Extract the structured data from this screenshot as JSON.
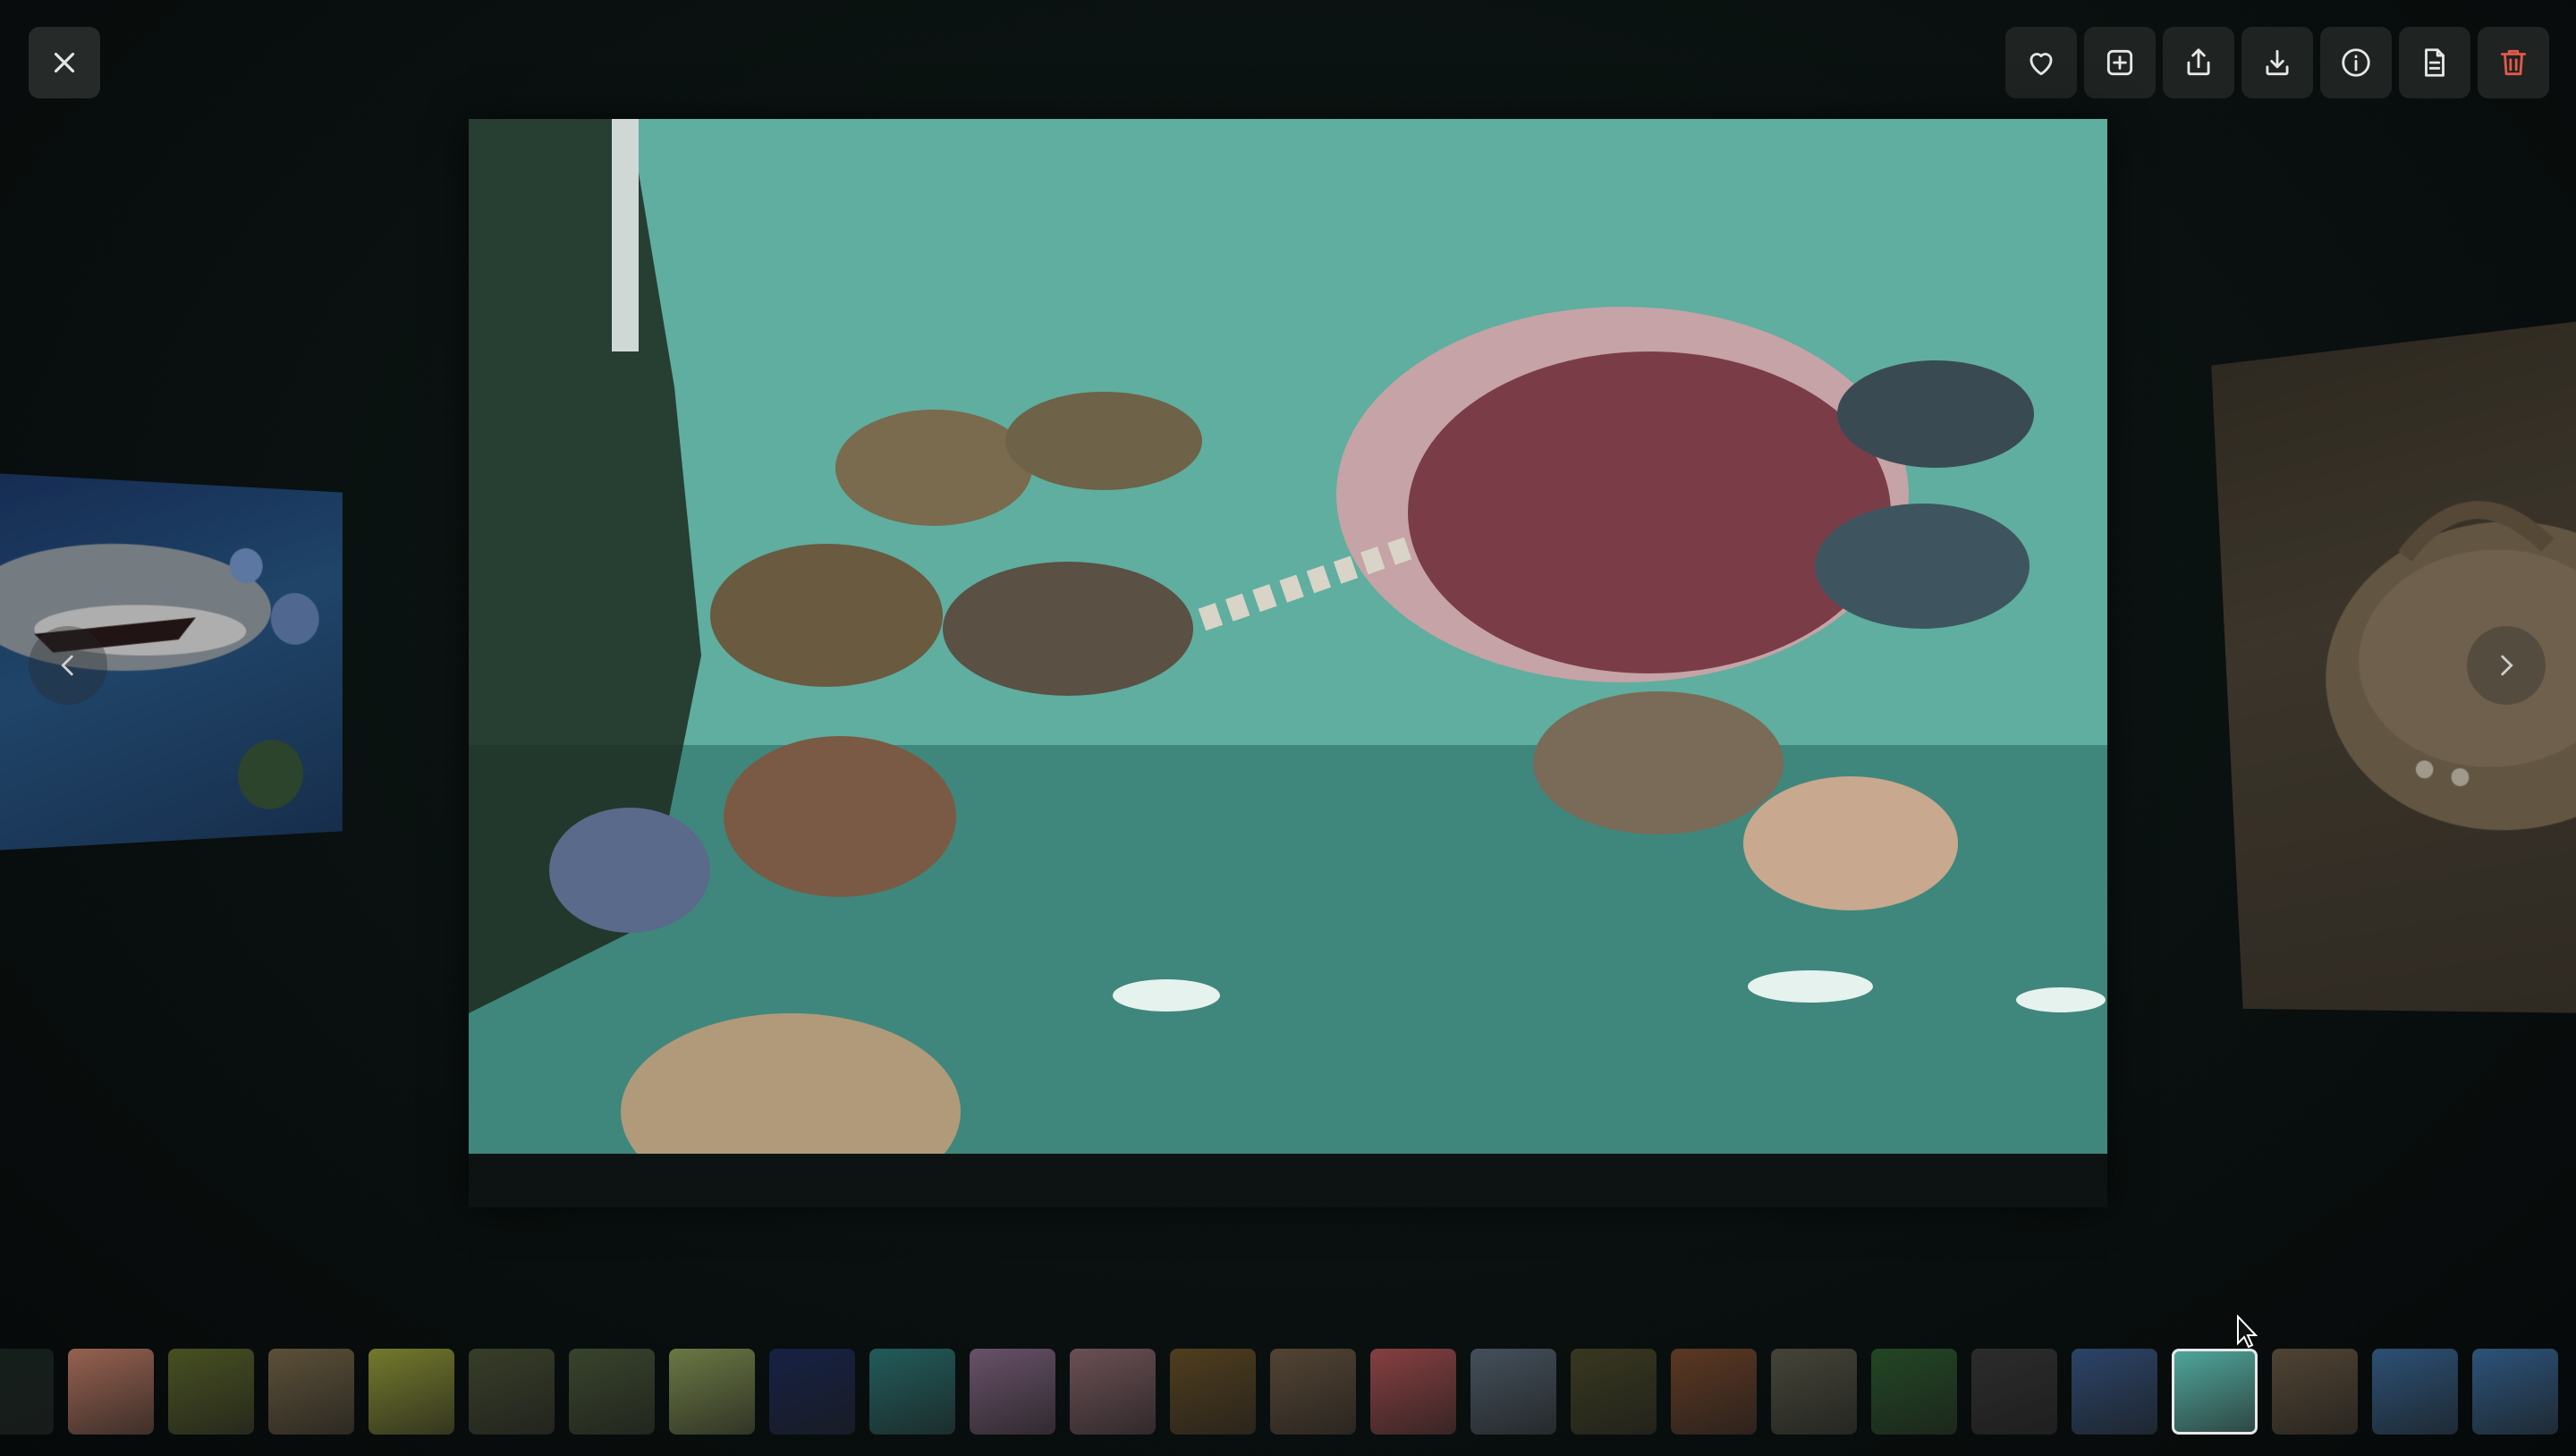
{
  "viewer": {
    "close_icon": "close-icon",
    "toolbar": [
      {
        "name": "favorite-button",
        "icon": "heart-icon"
      },
      {
        "name": "add-to-album-button",
        "icon": "plus-square-icon"
      },
      {
        "name": "share-button",
        "icon": "share-icon"
      },
      {
        "name": "download-button",
        "icon": "download-icon"
      },
      {
        "name": "info-button",
        "icon": "info-icon"
      },
      {
        "name": "file-info-button",
        "icon": "document-icon"
      },
      {
        "name": "delete-button",
        "icon": "trash-icon",
        "color": "#e05a4a"
      }
    ],
    "prev_icon": "chevron-left-icon",
    "next_icon": "chevron-right-icon"
  },
  "filmstrip": {
    "active_index": 22,
    "thumbs": [
      {
        "color": "#1a2a22"
      },
      {
        "color": "#c8826a"
      },
      {
        "color": "#5e6a2c"
      },
      {
        "color": "#7a6a4a"
      },
      {
        "color": "#9aa23a"
      },
      {
        "color": "#4a5236"
      },
      {
        "color": "#4a5a3a"
      },
      {
        "color": "#8ea05a"
      },
      {
        "color": "#1e2c5a"
      },
      {
        "color": "#2c7a78"
      },
      {
        "color": "#8a6c8a"
      },
      {
        "color": "#8e6a70"
      },
      {
        "color": "#6a5228"
      },
      {
        "color": "#6e5a44"
      },
      {
        "color": "#b25456"
      },
      {
        "color": "#5a6a78"
      },
      {
        "color": "#4a4a2a"
      },
      {
        "color": "#7a4a2e"
      },
      {
        "color": "#5a5a4a"
      },
      {
        "color": "#2e5e30"
      },
      {
        "color": "#3a3a3a"
      },
      {
        "color": "#3a5a8a"
      },
      {
        "color": "#4ea59a"
      },
      {
        "color": "#6a5a44"
      },
      {
        "color": "#3a6a9a"
      },
      {
        "color": "#3a6ea0"
      }
    ]
  }
}
